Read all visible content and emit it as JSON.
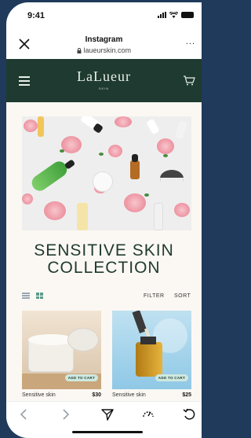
{
  "status_bar": {
    "time": "9:41"
  },
  "browser": {
    "title": "Instagram",
    "url": "laueurskin.com",
    "more": "..."
  },
  "header": {
    "logo": "LaLueur",
    "logo_sub": "SKIN"
  },
  "collection": {
    "title_line1": "SENSITIVE SKIN",
    "title_line2": "COLLECTION",
    "filter_label": "FILTER",
    "sort_label": "SORT"
  },
  "products": [
    {
      "name": "Sensitive skin",
      "price": "$30",
      "cta": "ADD TO CART"
    },
    {
      "name": "Sensitive skin",
      "price": "$25",
      "cta": "ADD TO CART"
    }
  ],
  "colors": {
    "brand": "#1f3a30",
    "background": "#fbf8f3",
    "badge": "#cfe8df"
  }
}
